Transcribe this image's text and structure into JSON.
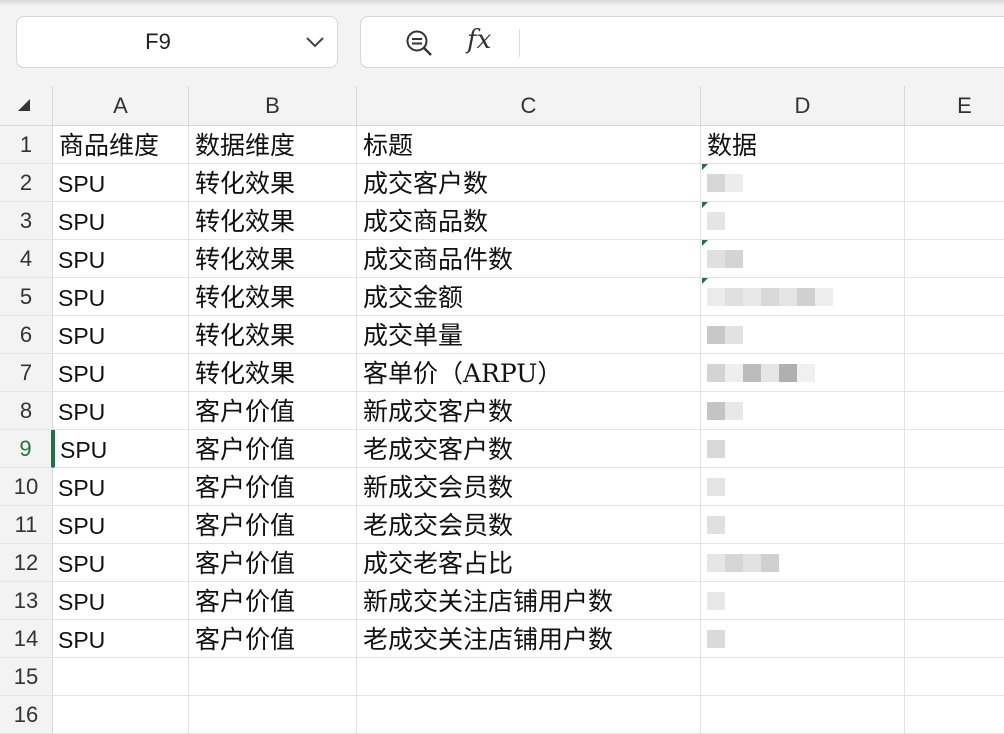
{
  "name_box": {
    "value": "F9"
  },
  "formula_bar": {
    "fx_label": "fx",
    "value": ""
  },
  "columns": [
    "A",
    "B",
    "C",
    "D",
    "E"
  ],
  "rows": [
    {
      "num": "1",
      "a": "商品维度",
      "b": "数据维度",
      "c": "标题",
      "d": "数据"
    },
    {
      "num": "2",
      "a": "SPU",
      "b": "转化效果",
      "c": "成交客户数",
      "d": ""
    },
    {
      "num": "3",
      "a": "SPU",
      "b": "转化效果",
      "c": "成交商品数",
      "d": ""
    },
    {
      "num": "4",
      "a": "SPU",
      "b": "转化效果",
      "c": "成交商品件数",
      "d": ""
    },
    {
      "num": "5",
      "a": "SPU",
      "b": "转化效果",
      "c": "成交金额",
      "d": ""
    },
    {
      "num": "6",
      "a": "SPU",
      "b": "转化效果",
      "c": "成交单量",
      "d": ""
    },
    {
      "num": "7",
      "a": "SPU",
      "b": "转化效果",
      "c": "客单价（ARPU）",
      "d": ""
    },
    {
      "num": "8",
      "a": "SPU",
      "b": "客户价值",
      "c": "新成交客户数",
      "d": ""
    },
    {
      "num": "9",
      "a": "SPU",
      "b": "客户价值",
      "c": "老成交客户数",
      "d": ""
    },
    {
      "num": "10",
      "a": "SPU",
      "b": "客户价值",
      "c": "新成交会员数",
      "d": ""
    },
    {
      "num": "11",
      "a": "SPU",
      "b": "客户价值",
      "c": "老成交会员数",
      "d": ""
    },
    {
      "num": "12",
      "a": "SPU",
      "b": "客户价值",
      "c": "成交老客占比",
      "d": ""
    },
    {
      "num": "13",
      "a": "SPU",
      "b": "客户价值",
      "c": "新成交关注店铺用户数",
      "d": ""
    },
    {
      "num": "14",
      "a": "SPU",
      "b": "客户价值",
      "c": "老成交关注店铺用户数",
      "d": ""
    },
    {
      "num": "15",
      "a": "",
      "b": "",
      "c": "",
      "d": ""
    },
    {
      "num": "16",
      "a": "",
      "b": "",
      "c": "",
      "d": ""
    }
  ],
  "active_row": "9",
  "colors": {
    "accent": "#217346",
    "header_bg": "#f3f3f3"
  }
}
